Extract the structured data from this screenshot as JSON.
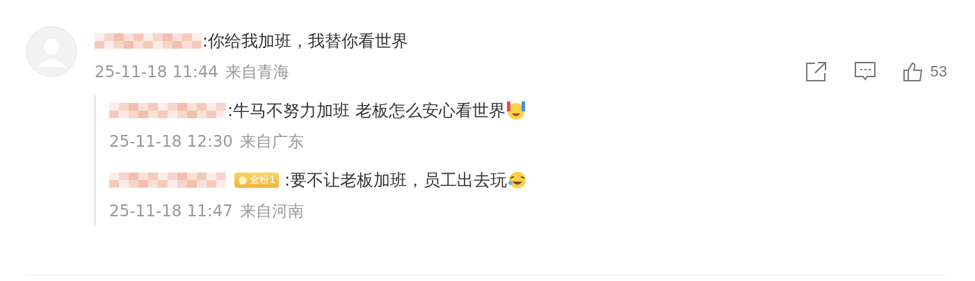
{
  "comment": {
    "text": ":你给我加班，我替你看世界",
    "time": "25-11-18 11:44",
    "source": "来自青海",
    "likes": "53"
  },
  "replies": [
    {
      "kind": "cheer",
      "text": ":牛马不努力加班 老板怎么安心看世界",
      "time": "25-11-18 12:30",
      "source": "来自广东"
    },
    {
      "kind": "laugh",
      "badge": "金粉1",
      "text": ":要不让老板加班，员工出去玩",
      "time": "25-11-18 11:47",
      "source": "来自河南"
    }
  ]
}
